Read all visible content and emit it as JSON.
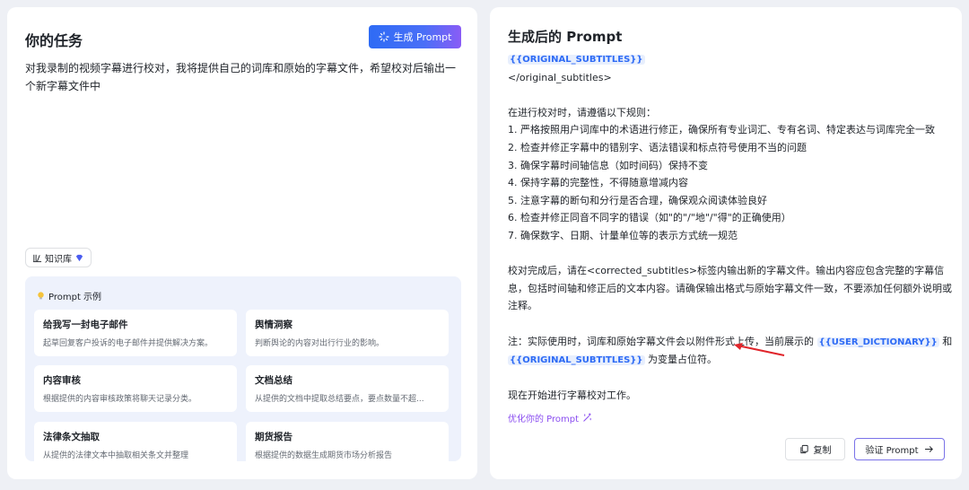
{
  "left": {
    "title": "你的任务",
    "generate_button": "生成 Prompt",
    "task_text": "对我录制的视频字幕进行校对，我将提供自己的词库和原始的字幕文件，希望校对后输出一个新字幕文件中",
    "knowledge_base": "知识库",
    "examples_title": "Prompt 示例",
    "examples": [
      {
        "title": "给我写一封电子邮件",
        "desc": "起草回复客户投诉的电子邮件并提供解决方案。"
      },
      {
        "title": "舆情洞察",
        "desc": "判断舆论的内容对出行行业的影响。"
      },
      {
        "title": "内容审核",
        "desc": "根据提供的内容审核政策将聊天记录分类。"
      },
      {
        "title": "文档总结",
        "desc": "从提供的文档中提取总结要点，要点数量不超..."
      },
      {
        "title": "法律条文抽取",
        "desc": "从提供的法律文本中抽取相关条文并整理"
      },
      {
        "title": "期货报告",
        "desc": "根据提供的数据生成期货市场分析报告"
      }
    ]
  },
  "right": {
    "title": "生成后的 Prompt",
    "var_original": "{{ORIGINAL_SUBTITLES}}",
    "close_tag": "</original_subtitles>",
    "rules_intro": "在进行校对时，请遵循以下规则：",
    "rules": [
      "1. 严格按照用户词库中的术语进行修正，确保所有专业词汇、专有名词、特定表达与词库完全一致",
      "2. 检查并修正字幕中的错别字、语法错误和标点符号使用不当的问题",
      "3. 确保字幕时间轴信息（如时间码）保持不变",
      "4. 保持字幕的完整性，不得随意增减内容",
      "5. 注意字幕的断句和分行是否合理，确保观众阅读体验良好",
      "6. 检查并修正同音不同字的错误（如\"的\"/\"地\"/\"得\"的正确使用）",
      "7. 确保数字、日期、计量单位等的表示方式统一规范"
    ],
    "after_text": "校对完成后，请在<corrected_subtitles>标签内输出新的字幕文件。输出内容应包含完整的字幕信息，包括时间轴和修正后的文本内容。请确保输出格式与原始字幕文件一致，不要添加任何额外说明或注释。",
    "note_prefix": "注：实际使用时，词库和原始字幕文件会以附件形式上传，当前展示的",
    "var_dict": "{{USER_DICTIONARY}}",
    "note_and": "和",
    "note_suffix": "为变量占位符。",
    "start_text": "现在开始进行字幕校对工作。",
    "optimize_link": "优化你的 Prompt",
    "copy_button": "复制",
    "verify_button": "验证 Prompt"
  },
  "colors": {
    "accent_blue": "#2e6bf5",
    "accent_purple": "#8a4df0",
    "annotation_red": "#e0242a"
  }
}
